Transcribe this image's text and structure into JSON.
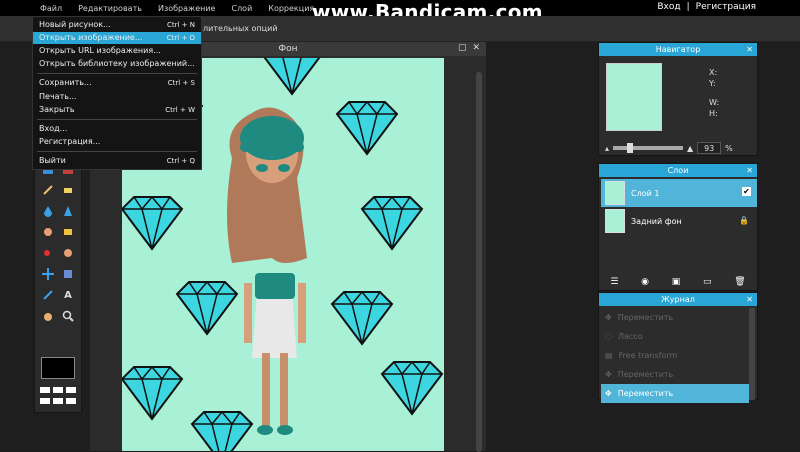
{
  "watermark": "www.Bandicam.com",
  "menubar": {
    "items": [
      "Файл",
      "Редактировать",
      "Изображение",
      "Слой",
      "Коррекция"
    ],
    "login": "Вход",
    "separator": "|",
    "register": "Регистрация"
  },
  "optbar": {
    "label": "лительных опций"
  },
  "file_menu": {
    "items": [
      {
        "label": "Новый рисунок...",
        "shortcut": "Ctrl + N"
      },
      {
        "label": "Открыть изображение...",
        "shortcut": "Ctrl + O"
      },
      {
        "label": "Открыть URL изображения...",
        "shortcut": ""
      },
      {
        "label": "Открыть библиотеку изображений...",
        "shortcut": ""
      },
      {
        "label": "Сохранить...",
        "shortcut": "Ctrl + S"
      },
      {
        "label": "Печать...",
        "shortcut": ""
      },
      {
        "label": "Закрыть",
        "shortcut": "Ctrl + W"
      },
      {
        "label": "Вход...",
        "shortcut": ""
      },
      {
        "label": "Регистрация...",
        "shortcut": ""
      },
      {
        "label": "Выйти",
        "shortcut": "Ctrl + Q"
      }
    ],
    "highlighted_index": 1
  },
  "document": {
    "title": "Фон",
    "restore_icon": "▢",
    "close_icon": "✕"
  },
  "navigator": {
    "title": "Навигатор",
    "close_icon": "✕",
    "x_label": "X:",
    "y_label": "Y:",
    "w_label": "W:",
    "h_label": "H:",
    "zoom_value": "93",
    "zoom_unit": "%"
  },
  "layers": {
    "title": "Слои",
    "close_icon": "✕",
    "items": [
      {
        "name": "Слой 1",
        "checked": "✔"
      },
      {
        "name": "Задний фон",
        "lock": "🔒"
      }
    ]
  },
  "history": {
    "title": "Журнал",
    "close_icon": "✕",
    "items": [
      "Переместить",
      "Лассо",
      "Free transform",
      "Переместить",
      "Переместить"
    ],
    "active_index": 4
  },
  "colors": {
    "accent": "#2aa6d6",
    "canvas_bg": "#a8f0d6",
    "diamond": "#3cd6e0"
  }
}
